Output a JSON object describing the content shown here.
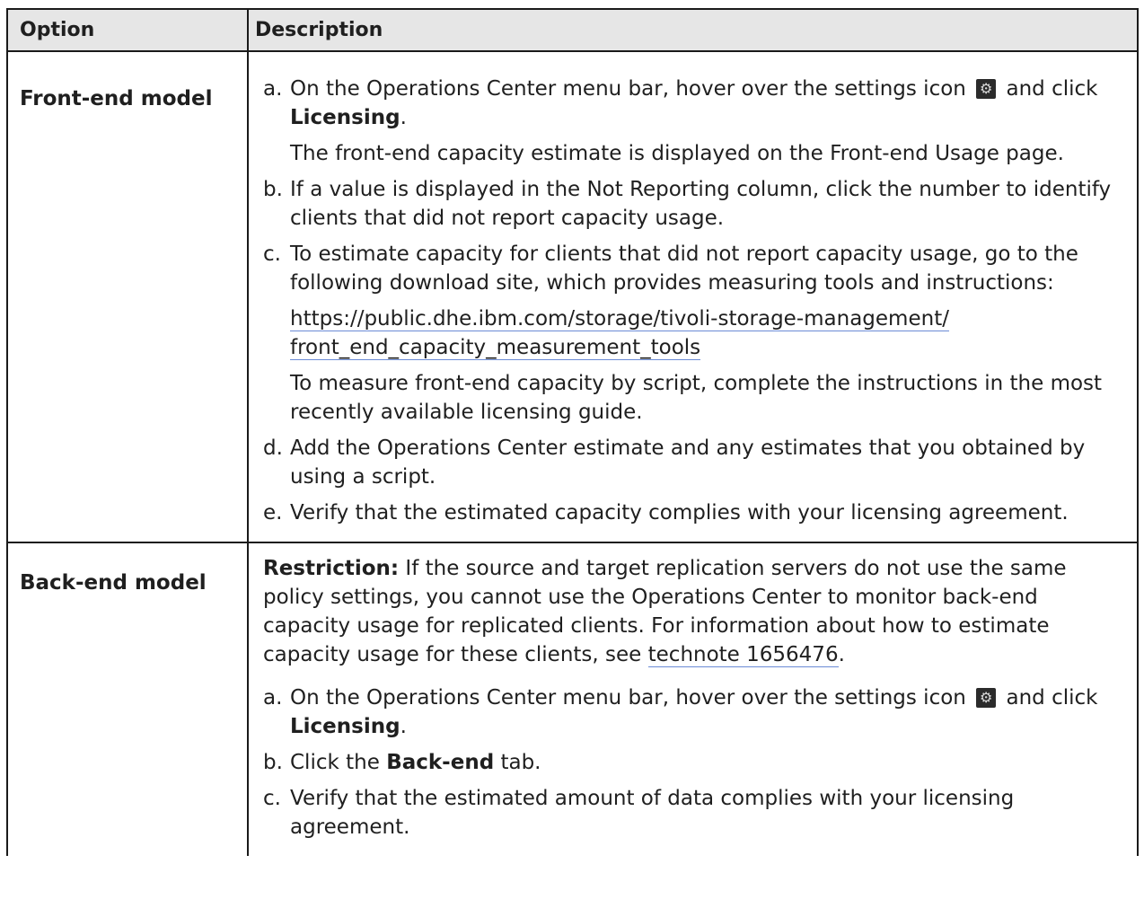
{
  "table": {
    "header_option": "Option",
    "header_description": "Description"
  },
  "front": {
    "label": "Front-end model",
    "a_marker": "a.",
    "a_text": "On the Operations Center menu bar, hover over the settings icon",
    "a_text2": "and click",
    "a_bold": "Licensing",
    "a_end": ".",
    "a_sub": "The front-end capacity estimate is displayed on the Front-end Usage page.",
    "b_marker": "b.",
    "b_text": "If a value is displayed in the Not Reporting column, click the number to identify clients that did not report capacity usage.",
    "c_marker": "c.",
    "c_text": "To estimate capacity for clients that did not report capacity usage, go to the following download site, which provides measuring tools and instructions:",
    "c_link_line1": "https://public.dhe.ibm.com/storage/tivoli-storage-management/",
    "c_link_line2": "front_end_capacity_measurement_tools",
    "c_sub": "To measure front-end capacity by script, complete the instructions in the most recently available licensing guide.",
    "d_marker": "d.",
    "d_text": "Add the Operations Center estimate and any estimates that you obtained by using a script.",
    "e_marker": "e.",
    "e_text": "Verify that the estimated capacity complies with your licensing agreement."
  },
  "back": {
    "label": "Back-end model",
    "restriction_label": "Restriction:",
    "restriction_text": "If the source and target replication servers do not use the same policy settings, you cannot use the Operations Center to monitor back-end capacity usage for replicated clients. For information about how to estimate capacity usage for these clients, see",
    "restriction_link": "technote 1656476",
    "restriction_end": ".",
    "a_marker": "a.",
    "a_text": "On the Operations Center menu bar, hover over the settings icon",
    "a_text2": "and click",
    "a_bold": "Licensing",
    "a_end": ".",
    "b_marker": "b.",
    "b_text1": "Click the",
    "b_bold": "Back-end",
    "b_text2": "tab.",
    "c_marker": "c.",
    "c_text": "Verify that the estimated amount of data complies with your licensing agreement."
  },
  "icons": {
    "settings_icon": "gear-icon",
    "settings_icon_glyph": "⚙"
  }
}
